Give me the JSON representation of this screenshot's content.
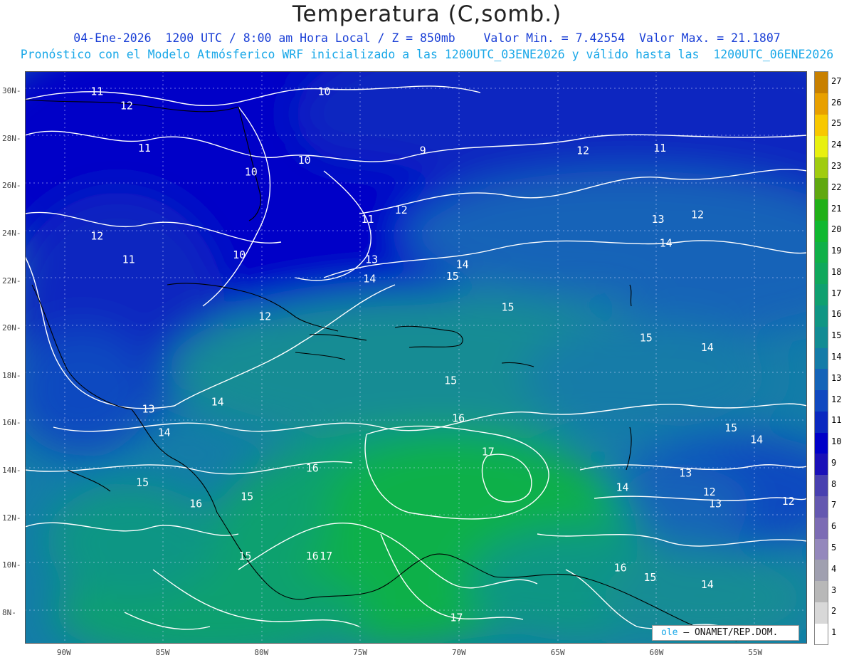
{
  "title": "Temperatura (C,somb.)",
  "subtitle1": "04-Ene-2026  1200 UTC / 8:00 am Hora Local / Z = 850mb    Valor Min. = 7.42554  Valor Max. = 21.1807",
  "subtitle2": "Pronóstico con el Modelo Atmósferico WRF inicializado a las 1200UTC_03ENE2026 y válido hasta las  1200UTC_06ENE2026",
  "credit": {
    "logo": "ole",
    "text": "– ONAMET/REP.DOM."
  },
  "colorbar": {
    "levels": [
      "1",
      "2",
      "3",
      "4",
      "5",
      "6",
      "7",
      "8",
      "9",
      "10",
      "11",
      "12",
      "13",
      "14",
      "15",
      "16",
      "17",
      "18",
      "19",
      "20",
      "21",
      "22",
      "23",
      "24",
      "25",
      "26",
      "27"
    ],
    "colors": [
      "#ffffff",
      "#d8d8d8",
      "#b8b8b8",
      "#a0a0b0",
      "#9488bc",
      "#7c6cb4",
      "#6458b0",
      "#4840b0",
      "#1a10b8",
      "#0000c8",
      "#0a28c0",
      "#1048c0",
      "#1464b8",
      "#147ca8",
      "#128c94",
      "#109684",
      "#10a070",
      "#10a85c",
      "#10b048",
      "#10b830",
      "#20b018",
      "#60a810",
      "#a0cc10",
      "#e8f010",
      "#f8c800",
      "#e8a000",
      "#c88000"
    ]
  },
  "axes": {
    "lon_labels": [
      "90W",
      "85W",
      "80W",
      "75W",
      "70W",
      "65W",
      "60W",
      "55W"
    ],
    "lat_labels": [
      "30N",
      "28N",
      "26N",
      "24N",
      "22N",
      "20N",
      "18N",
      "16N",
      "14N",
      "12N",
      "10N",
      "8N"
    ]
  },
  "contour_labels": [
    {
      "t": "11",
      "lon": -88.4,
      "lat": 30.0
    },
    {
      "t": "10",
      "lon": -76.9,
      "lat": 30.0
    },
    {
      "t": "12",
      "lon": -86.9,
      "lat": 29.4
    },
    {
      "t": "11",
      "lon": -86.0,
      "lat": 27.6
    },
    {
      "t": "10",
      "lon": -77.9,
      "lat": 27.1
    },
    {
      "t": "9",
      "lon": -71.9,
      "lat": 27.5
    },
    {
      "t": "12",
      "lon": -63.8,
      "lat": 27.5
    },
    {
      "t": "11",
      "lon": -59.9,
      "lat": 27.6
    },
    {
      "t": "10",
      "lon": -80.6,
      "lat": 26.6
    },
    {
      "t": "12",
      "lon": -88.4,
      "lat": 23.9
    },
    {
      "t": "11",
      "lon": -74.7,
      "lat": 24.6
    },
    {
      "t": "12",
      "lon": -73.0,
      "lat": 25.0
    },
    {
      "t": "13",
      "lon": -60.0,
      "lat": 24.6
    },
    {
      "t": "12",
      "lon": -58.0,
      "lat": 24.8
    },
    {
      "t": "11",
      "lon": -86.8,
      "lat": 22.9
    },
    {
      "t": "10",
      "lon": -81.2,
      "lat": 23.1
    },
    {
      "t": "13",
      "lon": -74.5,
      "lat": 22.9
    },
    {
      "t": "14",
      "lon": -69.9,
      "lat": 22.7
    },
    {
      "t": "14",
      "lon": -59.6,
      "lat": 23.6
    },
    {
      "t": "14",
      "lon": -74.6,
      "lat": 22.1
    },
    {
      "t": "15",
      "lon": -70.4,
      "lat": 22.2
    },
    {
      "t": "12",
      "lon": -79.9,
      "lat": 20.5
    },
    {
      "t": "15",
      "lon": -67.6,
      "lat": 20.9
    },
    {
      "t": "15",
      "lon": -60.6,
      "lat": 19.6
    },
    {
      "t": "14",
      "lon": -57.5,
      "lat": 19.2
    },
    {
      "t": "15",
      "lon": -70.5,
      "lat": 17.8
    },
    {
      "t": "13",
      "lon": -85.8,
      "lat": 16.6
    },
    {
      "t": "14",
      "lon": -82.3,
      "lat": 16.9
    },
    {
      "t": "16",
      "lon": -70.1,
      "lat": 16.2
    },
    {
      "t": "14",
      "lon": -85.0,
      "lat": 15.6
    },
    {
      "t": "15",
      "lon": -56.3,
      "lat": 15.8
    },
    {
      "t": "14",
      "lon": -55.0,
      "lat": 15.3
    },
    {
      "t": "17",
      "lon": -68.6,
      "lat": 14.8
    },
    {
      "t": "16",
      "lon": -77.5,
      "lat": 14.1
    },
    {
      "t": "15",
      "lon": -86.1,
      "lat": 13.5
    },
    {
      "t": "13",
      "lon": -58.6,
      "lat": 13.9
    },
    {
      "t": "14",
      "lon": -61.8,
      "lat": 13.3
    },
    {
      "t": "12",
      "lon": -57.4,
      "lat": 13.1
    },
    {
      "t": "13",
      "lon": -57.1,
      "lat": 12.6
    },
    {
      "t": "12",
      "lon": -53.4,
      "lat": 12.7
    },
    {
      "t": "15",
      "lon": -80.8,
      "lat": 12.9
    },
    {
      "t": "16",
      "lon": -83.4,
      "lat": 12.6
    },
    {
      "t": "15",
      "lon": -80.9,
      "lat": 10.4
    },
    {
      "t": "16",
      "lon": -77.5,
      "lat": 10.4
    },
    {
      "t": "17",
      "lon": -76.8,
      "lat": 10.4
    },
    {
      "t": "16",
      "lon": -61.9,
      "lat": 9.9
    },
    {
      "t": "15",
      "lon": -60.4,
      "lat": 9.5
    },
    {
      "t": "14",
      "lon": -57.5,
      "lat": 9.2
    },
    {
      "t": "17",
      "lon": -70.2,
      "lat": 7.8
    }
  ]
}
